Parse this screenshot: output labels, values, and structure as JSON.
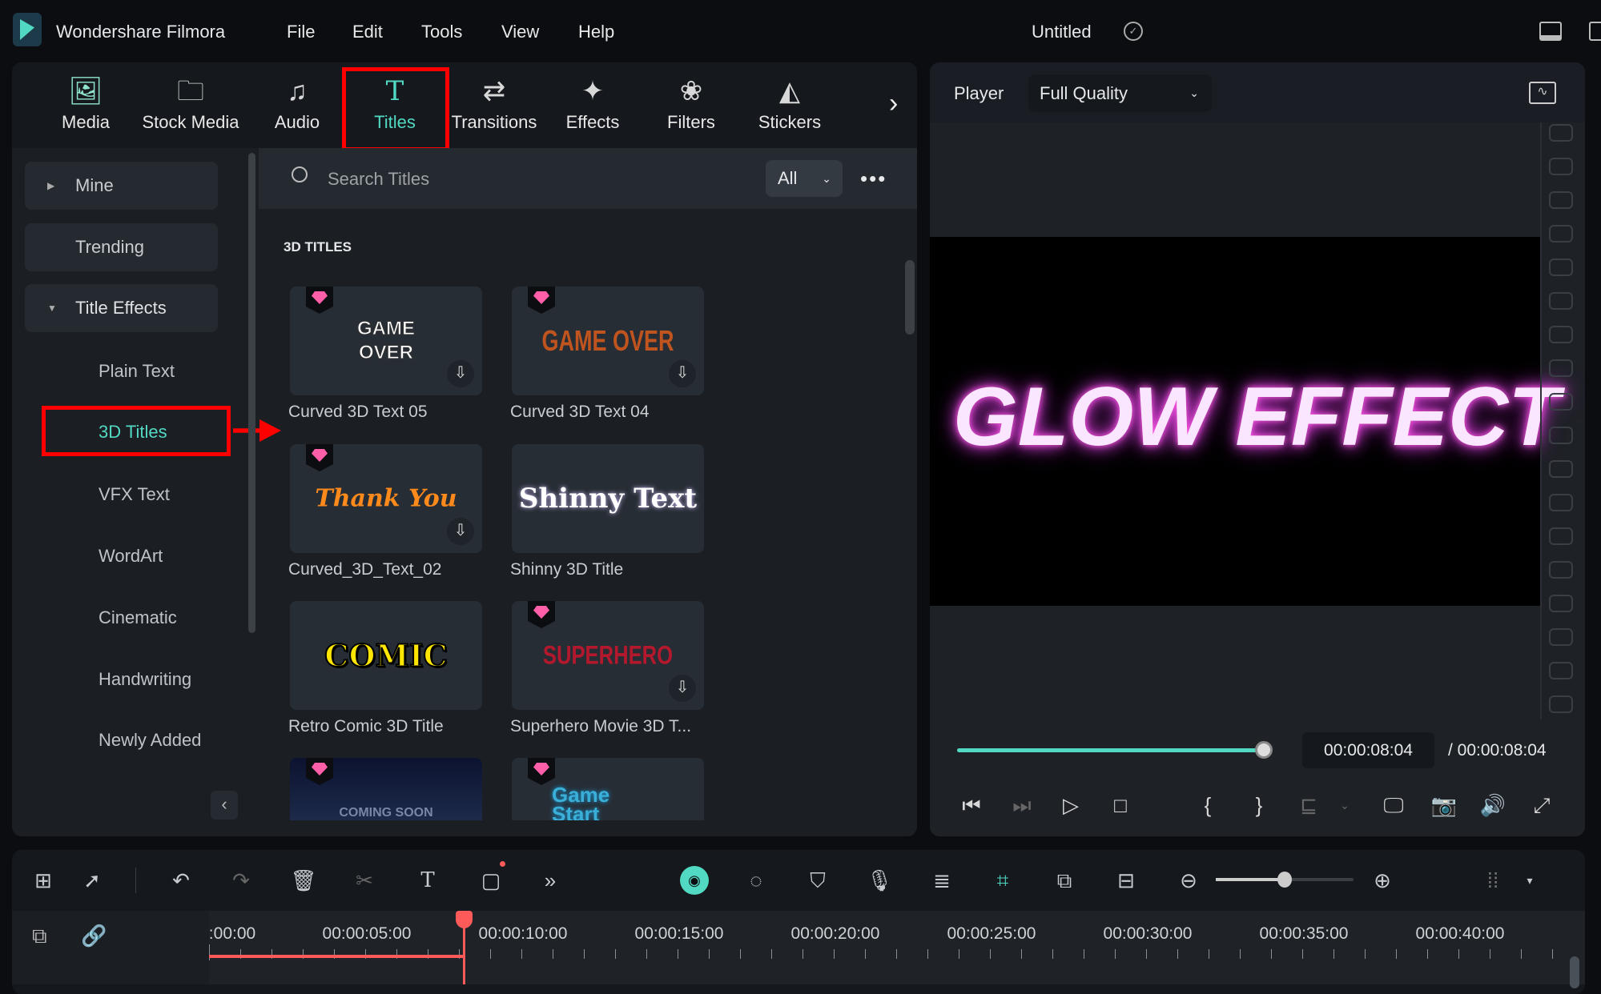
{
  "app": {
    "name": "Wondershare Filmora",
    "project_title": "Untitled"
  },
  "menu": [
    "File",
    "Edit",
    "Tools",
    "View",
    "Help"
  ],
  "tabs": [
    {
      "label": "Media",
      "icon": "media-icon"
    },
    {
      "label": "Stock Media",
      "icon": "stock-media-icon"
    },
    {
      "label": "Audio",
      "icon": "music-note-icon"
    },
    {
      "label": "Titles",
      "icon": "text-t-icon",
      "active": true
    },
    {
      "label": "Transitions",
      "icon": "transitions-icon"
    },
    {
      "label": "Effects",
      "icon": "effects-star-icon"
    },
    {
      "label": "Filters",
      "icon": "filters-icon"
    },
    {
      "label": "Stickers",
      "icon": "stickers-icon"
    }
  ],
  "sidebar": {
    "mine": "Mine",
    "trending": "Trending",
    "title_effects": "Title Effects",
    "items": [
      "Plain Text",
      "3D Titles",
      "VFX Text",
      "WordArt",
      "Cinematic",
      "Handwriting",
      "Newly Added"
    ],
    "selected": "3D Titles"
  },
  "search": {
    "placeholder": "Search Titles",
    "filter": "All"
  },
  "section_title": "3D TITLES",
  "cards": [
    {
      "label": "Curved 3D Text 05",
      "thumb": "GAME OVER",
      "premium": true,
      "download": true
    },
    {
      "label": "Curved 3D Text 04",
      "thumb": "GAME OVER",
      "premium": true,
      "download": true
    },
    {
      "label": "Curved_3D_Text_02",
      "thumb": "Thank You",
      "premium": true,
      "download": true
    },
    {
      "label": "Shinny 3D Title",
      "thumb": "Shinny Text",
      "premium": false,
      "download": false
    },
    {
      "label": "Retro Comic 3D Title",
      "thumb": "COMIC",
      "premium": false,
      "download": false
    },
    {
      "label": "Superhero Movie 3D T...",
      "thumb": "SUPERHERO",
      "premium": true,
      "download": true
    },
    {
      "label": "",
      "thumb": "COMING SOON",
      "premium": true,
      "download": false
    },
    {
      "label": "",
      "thumb": "Game Start",
      "premium": true,
      "download": false
    }
  ],
  "player": {
    "label": "Player",
    "quality": "Full Quality",
    "preview_text": "GLOW EFFECT",
    "current_time": "00:00:08:04",
    "total_time": "/ 00:00:08:04",
    "progress": 1.0
  },
  "timeline": {
    "labels": [
      ":00:00",
      "00:00:05:00",
      "00:00:10:00",
      "00:00:15:00",
      "00:00:20:00",
      "00:00:25:00",
      "00:00:30:00",
      "00:00:35:00",
      "00:00:40:00"
    ],
    "playhead": "00:00:08:04",
    "zoom_level": 0.5
  },
  "colors": {
    "accent": "#52d9c3",
    "highlight_box": "#ff0000",
    "playhead": "#ff5a5a",
    "premium_gem": "#ff5fa8"
  }
}
